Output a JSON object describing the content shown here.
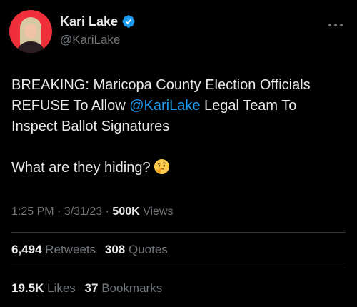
{
  "author": {
    "display_name": "Kari Lake",
    "handle": "@KariLake",
    "verified": true,
    "avatar_bg": "#ef2f39"
  },
  "tweet": {
    "line1": "BREAKING: Maricopa County Election Officials",
    "line2_before": "REFUSE To Allow ",
    "mention": "@KariLake",
    "line2_after": " Legal Team To",
    "line3": "Inspect Ballot Signatures",
    "line4": "What are they hiding?",
    "emoji": "thinking-face-icon"
  },
  "meta": {
    "time": "1:25 PM",
    "sep1": " · ",
    "date": "3/31/23",
    "sep2": " · ",
    "views_count": "500K",
    "views_label": " Views"
  },
  "stats": {
    "retweets_count": "6,494",
    "retweets_label": "Retweets",
    "quotes_count": "308",
    "quotes_label": "Quotes",
    "likes_count": "19.5K",
    "likes_label": "Likes",
    "bookmarks_count": "37",
    "bookmarks_label": "Bookmarks"
  },
  "colors": {
    "background": "#000000",
    "text": "#e7e9ea",
    "secondary": "#71767b",
    "accent": "#1d9bf0",
    "divider": "#2f3336"
  }
}
